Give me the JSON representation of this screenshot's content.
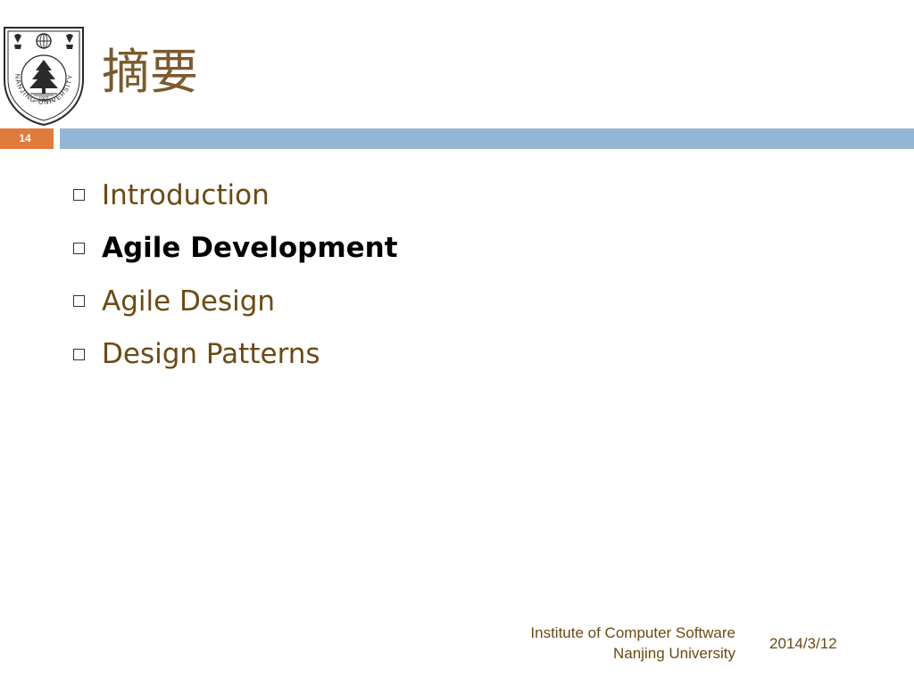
{
  "slide": {
    "title": "摘要",
    "number": "14",
    "bullets": [
      {
        "text": "Introduction",
        "emphasized": false
      },
      {
        "text": "Agile Development",
        "emphasized": true
      },
      {
        "text": "Agile Design",
        "emphasized": false
      },
      {
        "text": "Design Patterns",
        "emphasized": false
      }
    ]
  },
  "logo": {
    "icon": "nanjing-university-seal-icon",
    "ring_text": "NANJING UNIVERSITY",
    "year": "1902"
  },
  "footer": {
    "institute_line1": "Institute of Computer Software",
    "institute_line2": "Nanjing University",
    "date": "2014/3/12"
  },
  "colors": {
    "title": "#7a5a2e",
    "bullet_text": "#6b4a12",
    "bullet_emphasis": "#000000",
    "number_box": "#e07b3a",
    "header_bar": "#93b6d4",
    "seal": "#2a2a2a"
  }
}
